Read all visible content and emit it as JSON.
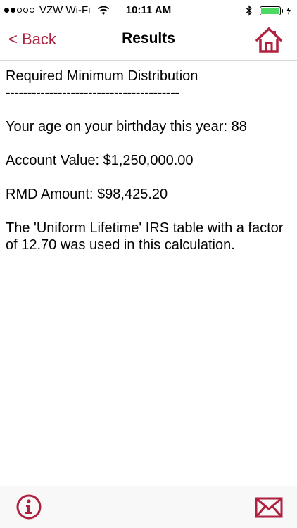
{
  "status_bar": {
    "carrier": "VZW Wi-Fi",
    "time": "10:11 AM",
    "signal_filled": 2,
    "signal_total": 5,
    "battery_level": 1.0,
    "icons": [
      "wifi-icon",
      "bluetooth-icon",
      "battery-icon",
      "charging-icon"
    ]
  },
  "nav": {
    "back_label": "< Back",
    "title": "Results",
    "home_icon": "home-icon"
  },
  "results": {
    "heading": "Required Minimum Distribution",
    "divider": "----------------------------------------",
    "age_line": "Your age on your birthday this year: 88",
    "account_value_line": "Account Value: $1,250,000.00",
    "rmd_amount_line": "RMD Amount: $98,425.20",
    "table_note": "The 'Uniform Lifetime' IRS table with a factor of 12.70 was used in this calculation."
  },
  "toolbar": {
    "info_icon": "info-icon",
    "mail_icon": "mail-icon"
  },
  "colors": {
    "accent": "#b0213f",
    "battery": "#4cd964"
  }
}
